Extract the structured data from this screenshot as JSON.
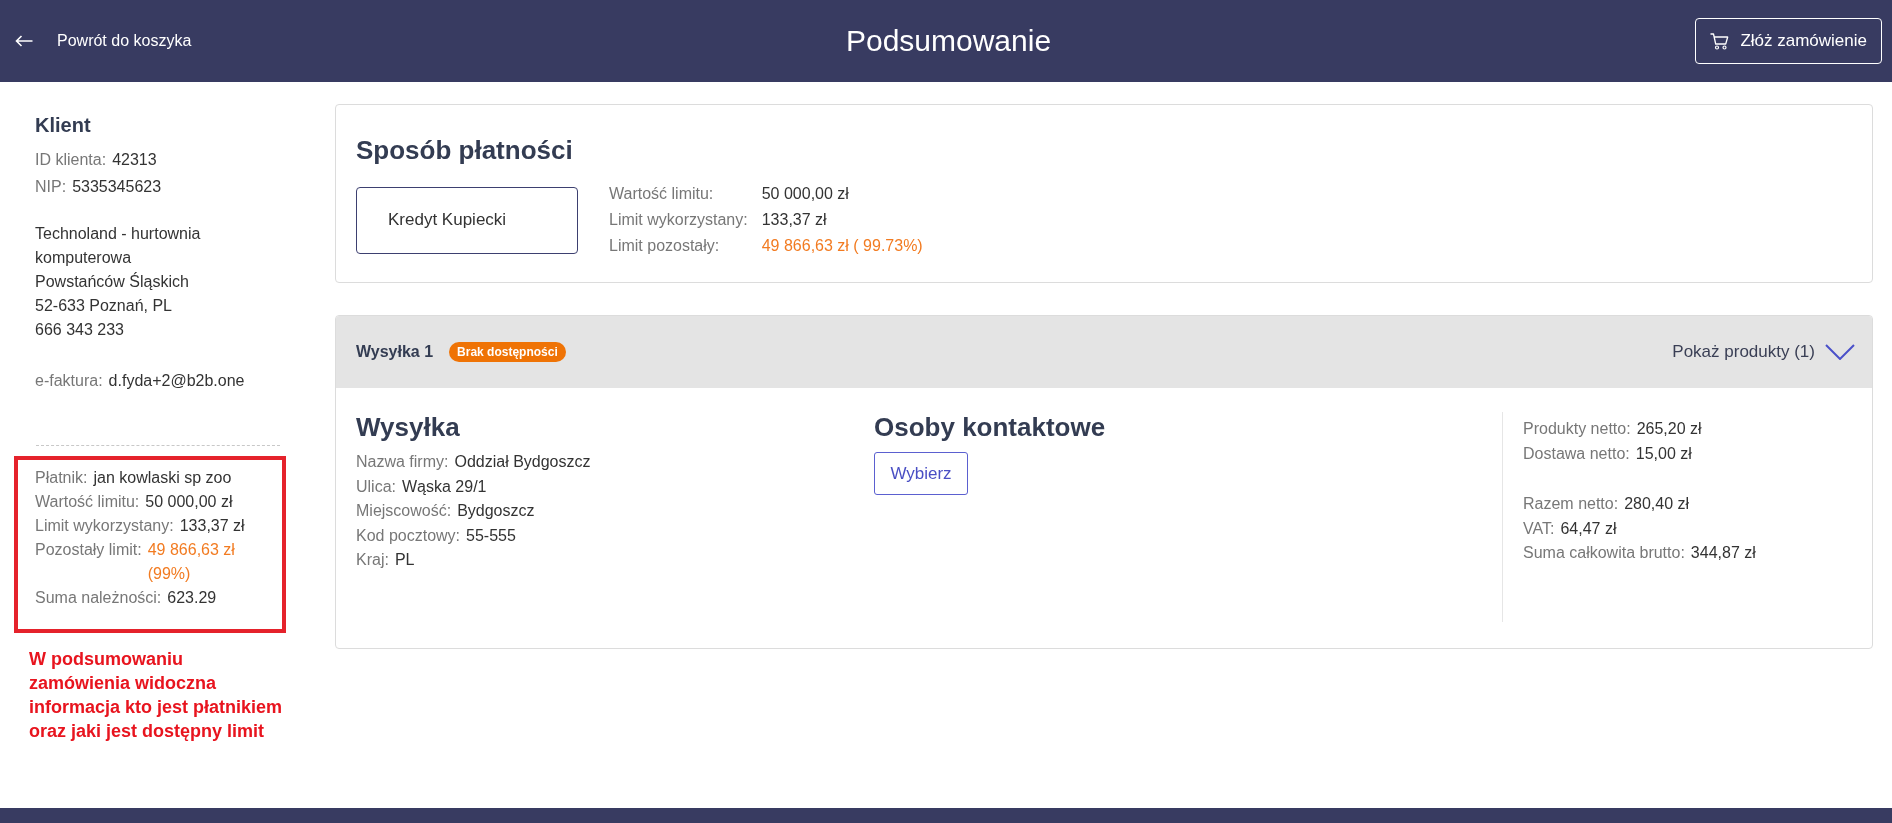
{
  "header": {
    "back_link": "Powrót do koszyka",
    "title": "Podsumowanie",
    "order_button": "Złóż zamówienie"
  },
  "client": {
    "title": "Klient",
    "identifiers": [
      {
        "label": "ID klienta:",
        "value": "42313"
      },
      {
        "label": "NIP:",
        "value": "5335345623"
      }
    ],
    "address": [
      "Technoland - hurtownia komputerowa",
      "Powstańców Śląskich",
      "52-633 Poznań, PL",
      "666 343 233"
    ],
    "e_invoice": {
      "label": "e-faktura:",
      "value": "d.fyda+2@b2b.one"
    }
  },
  "payer_info": [
    {
      "label": "Płatnik:",
      "value": "jan kowlaski sp zoo",
      "highlight": false
    },
    {
      "label": "Wartość limitu:",
      "value": "50 000,00 zł",
      "highlight": false
    },
    {
      "label": "Limit wykorzystany:",
      "value": "133,37 zł",
      "highlight": false
    },
    {
      "label": "Pozostały limit:",
      "value": "49 866,63 zł (99%)",
      "highlight": true
    },
    {
      "label": "Suma należności:",
      "value": "623.29",
      "highlight": false
    }
  ],
  "annotation": {
    "note": "W podsumowaniu zamówienia widoczna informacja kto jest płatnikiem oraz jaki jest dostępny limit"
  },
  "payment": {
    "title": "Sposób płatności",
    "methods": [
      {
        "label": "Kredyt Kupiecki",
        "selected": true
      }
    ],
    "limits": [
      {
        "label": "Wartość limitu:",
        "value": "50 000,00 zł",
        "highlight": false
      },
      {
        "label": "Limit wykorzystany:",
        "value": "133,37 zł",
        "highlight": false
      },
      {
        "label": "Limit pozostały:",
        "value": "49 866,63 zł ( 99.73%)",
        "highlight": true
      }
    ]
  },
  "shipments": [
    {
      "title": "Wysyłka 1",
      "badge": "Brak dostępności",
      "toggle": {
        "label": "Pokaż produkty (1)",
        "expanded": false
      },
      "delivery": {
        "title": "Wysyłka",
        "fields": [
          {
            "label": "Nazwa firmy:",
            "value": "Oddział Bydgoszcz"
          },
          {
            "label": "Ulica:",
            "value": "Wąska 29/1"
          },
          {
            "label": "Miejscowość:",
            "value": "Bydgoszcz"
          },
          {
            "label": "Kod pocztowy:",
            "value": "55-555"
          },
          {
            "label": "Kraj:",
            "value": "PL"
          }
        ]
      },
      "contacts": {
        "title": "Osoby kontaktowe",
        "button": "Wybierz"
      },
      "totals": {
        "groups": [
          {
            "rows": [
              {
                "label": "Produkty netto:",
                "value": "265,20 zł"
              },
              {
                "label": "Dostawa netto:",
                "value": "15,00 zł"
              }
            ]
          },
          {
            "rows": [
              {
                "label": "Razem netto:",
                "value": "280,40 zł"
              },
              {
                "label": "VAT:",
                "value": "64,47 zł"
              },
              {
                "label": "Suma całkowita brutto:",
                "value": "344,87 zł"
              }
            ]
          }
        ]
      }
    }
  ]
}
